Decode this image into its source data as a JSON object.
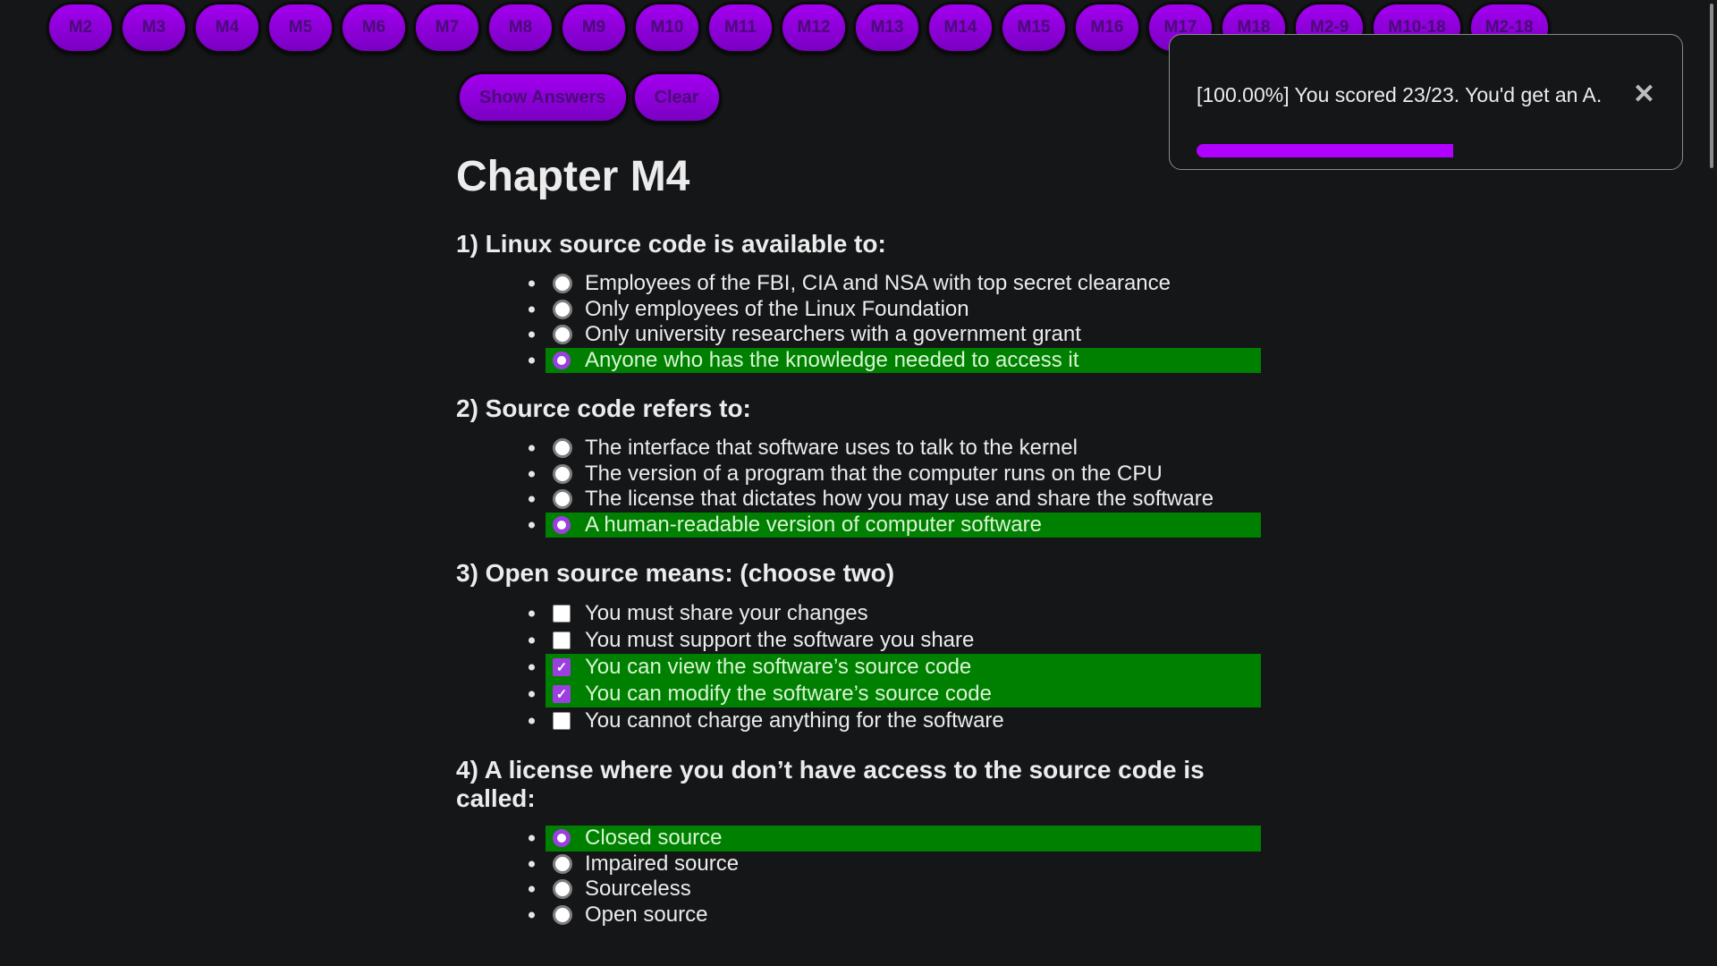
{
  "nav": {
    "chapters": [
      "M2",
      "M3",
      "M4",
      "M5",
      "M6",
      "M7",
      "M8",
      "M9",
      "M10",
      "M11",
      "M12",
      "M13",
      "M14",
      "M15",
      "M16",
      "M17",
      "M18",
      "M2-9",
      "M10-18",
      "M2-18"
    ]
  },
  "actions": {
    "show_answers_label": "Show Answers",
    "clear_label": "Clear"
  },
  "chapter_title": "Chapter M4",
  "questions": [
    {
      "title": "1) Linux source code is available to:",
      "type": "radio",
      "options": [
        {
          "text": "Employees of the FBI, CIA and NSA with top secret clearance",
          "selected": false,
          "correct": false
        },
        {
          "text": "Only employees of the Linux Foundation",
          "selected": false,
          "correct": false
        },
        {
          "text": "Only university researchers with a government grant",
          "selected": false,
          "correct": false
        },
        {
          "text": "Anyone who has the knowledge needed to access it",
          "selected": true,
          "correct": true
        }
      ]
    },
    {
      "title": "2) Source code refers to:",
      "type": "radio",
      "options": [
        {
          "text": "The interface that software uses to talk to the kernel",
          "selected": false,
          "correct": false
        },
        {
          "text": "The version of a program that the computer runs on the CPU",
          "selected": false,
          "correct": false
        },
        {
          "text": "The license that dictates how you may use and share the software",
          "selected": false,
          "correct": false
        },
        {
          "text": "A human-readable version of computer software",
          "selected": true,
          "correct": true
        }
      ]
    },
    {
      "title": "3) Open source means: (choose two)",
      "type": "checkbox",
      "options": [
        {
          "text": "You must share your changes",
          "selected": false,
          "correct": false
        },
        {
          "text": "You must support the software you share",
          "selected": false,
          "correct": false
        },
        {
          "text": "You can view the software’s source code",
          "selected": true,
          "correct": true
        },
        {
          "text": "You can modify the software’s source code",
          "selected": true,
          "correct": true
        },
        {
          "text": "You cannot charge anything for the software",
          "selected": false,
          "correct": false
        }
      ]
    },
    {
      "title": "4) A license where you don’t have access to the source code is called:",
      "type": "radio",
      "options": [
        {
          "text": "Closed source",
          "selected": true,
          "correct": true
        },
        {
          "text": "Impaired source",
          "selected": false,
          "correct": false
        },
        {
          "text": "Sourceless",
          "selected": false,
          "correct": false
        },
        {
          "text": "Open source",
          "selected": false,
          "correct": false
        }
      ]
    }
  ],
  "toast": {
    "message": "[100.00%] You scored 23/23. You'd get an A.",
    "close_icon": "close-icon",
    "close_glyph": "✕",
    "timer_remaining_fraction": 0.56
  },
  "colors": {
    "accent_purple": "#a300f0",
    "correct_green": "#008000",
    "background": "#151618"
  }
}
